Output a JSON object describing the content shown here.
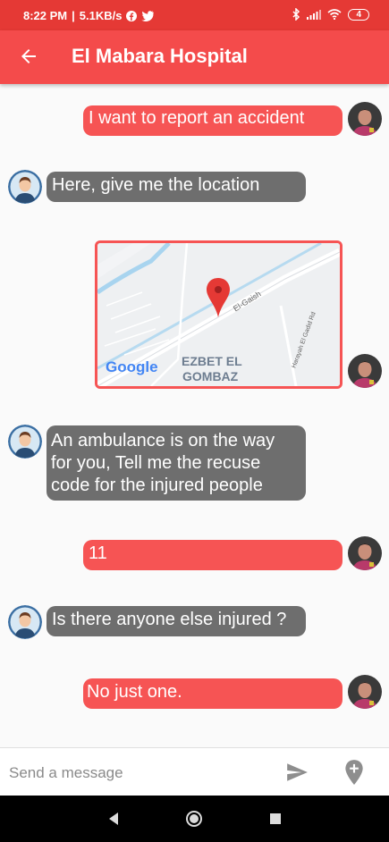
{
  "status_bar": {
    "time": "8:22 PM",
    "network_speed": "5.1KB/s",
    "battery": "4"
  },
  "app_bar": {
    "title": "El Mabara Hospital",
    "back_icon": "arrow-left-icon"
  },
  "messages": [
    {
      "sender": "user",
      "text": "I want to report an accident"
    },
    {
      "sender": "bot",
      "text": "Here, give me the location"
    },
    {
      "sender": "user",
      "type": "map",
      "labels": {
        "road": "El-Gaish",
        "road2": "Harayah El Gadid Rd",
        "area_line1": "EZBET EL",
        "area_line2": "GOMBAZ",
        "logo": "Google"
      }
    },
    {
      "sender": "bot",
      "text_lines": [
        "An ambulance is on the way",
        "for you, Tell me the recuse",
        "code for the injured people"
      ]
    },
    {
      "sender": "user",
      "text": "11"
    },
    {
      "sender": "bot",
      "text": "Is there anyone else injured ?"
    },
    {
      "sender": "user",
      "text": "No just one."
    }
  ],
  "composer": {
    "placeholder": "Send a message",
    "send_icon": "send-icon",
    "location_icon": "add-location-icon"
  },
  "colors": {
    "primary": "#f44b4b",
    "status_bar": "#e53935",
    "user_bubble": "#f65454",
    "bot_bubble": "#6e6e6e"
  }
}
